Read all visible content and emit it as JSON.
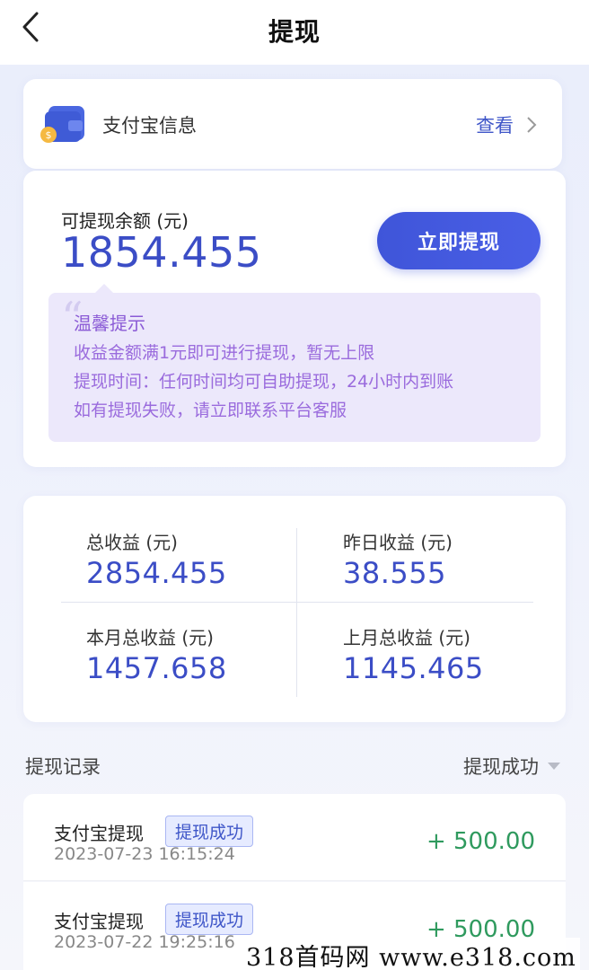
{
  "header": {
    "title": "提现"
  },
  "alipay": {
    "label": "支付宝信息",
    "link": "查看"
  },
  "balance": {
    "label": "可提现余额 (元)",
    "value": "1854.455",
    "button": "立即提现"
  },
  "tips": {
    "title": "温馨提示",
    "lines": [
      "收益金额满1元即可进行提现，暂无上限",
      "提现时间：任何时间均可自助提现，24小时内到账",
      "如有提现失败，请立即联系平台客服"
    ]
  },
  "stats": {
    "total_label": "总收益 (元)",
    "total_value": "2854.455",
    "yesterday_label": "昨日收益 (元)",
    "yesterday_value": "38.555",
    "month_label": "本月总收益 (元)",
    "month_value": "1457.658",
    "last_month_label": "上月总收益 (元)",
    "last_month_value": "1145.465"
  },
  "records": {
    "title": "提现记录",
    "filter": "提现成功",
    "items": [
      {
        "name": "支付宝提现",
        "status": "提现成功",
        "time": "2023-07-23 16:15:24",
        "amount": "+ 500.00"
      },
      {
        "name": "支付宝提现",
        "status": "提现成功",
        "time": "2023-07-22 19:25:16",
        "amount": "+ 500.00"
      }
    ]
  },
  "watermark": "318首码网  www.e318.com",
  "colors": {
    "accent": "#3f55d9",
    "amount": "#2f9a5e",
    "tip_text": "#9a6bdd"
  }
}
